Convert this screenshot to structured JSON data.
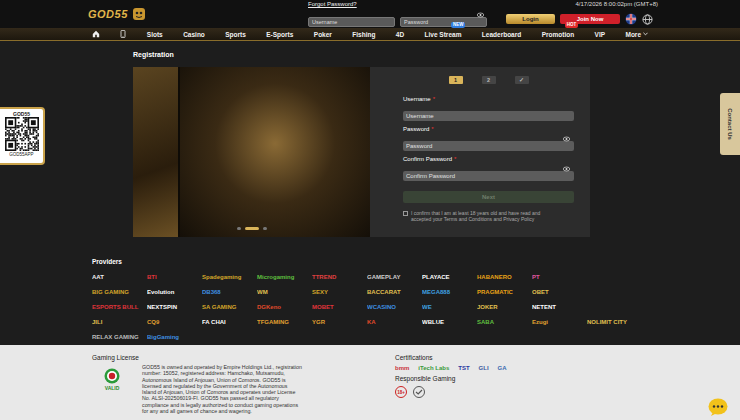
{
  "header": {
    "logo": "GOD55",
    "forgot_password": "Forgot Password?",
    "username": {
      "placeholder": "Username"
    },
    "password": {
      "placeholder": "Password"
    },
    "login": "Login",
    "join": "Join Now",
    "datetime": "4/17/2026 8:00:02pm (GMT+8)"
  },
  "nav": [
    {
      "label": "Slots"
    },
    {
      "label": "Casino"
    },
    {
      "label": "Sports"
    },
    {
      "label": "E-Sports"
    },
    {
      "label": "Poker"
    },
    {
      "label": "Fishing"
    },
    {
      "label": "4D"
    },
    {
      "label": "Live Stream",
      "badge": "NEW",
      "badge_color": "#2f7de1"
    },
    {
      "label": "Leaderboard"
    },
    {
      "label": "Promotion",
      "badge": "HOT",
      "badge_color": "#e02a2a"
    },
    {
      "label": "VIP"
    },
    {
      "label": "More"
    }
  ],
  "registration": {
    "title": "Registration",
    "slides": [
      {
        "selected": false
      },
      {
        "selected": true
      },
      {
        "selected": false
      }
    ],
    "steps": [
      {
        "label": "1",
        "selected": true
      },
      {
        "label": "2",
        "selected": false
      },
      {
        "label": "✓",
        "selected": false
      }
    ],
    "fields": [
      {
        "label": "Username",
        "required": "*",
        "placeholder": "Username",
        "kind": "text"
      },
      {
        "label": "Password",
        "required": "*",
        "placeholder": "Password",
        "kind": "password"
      },
      {
        "label": "Confirm Password",
        "required": "*",
        "placeholder": "Confirm Password",
        "kind": "password"
      }
    ],
    "submit": {
      "label": "Next",
      "disabled": true
    },
    "agree": {
      "text": "I confirm that I am at least 18 years old and have read and accepted your Terms and Conditions and Privacy Policy",
      "checked": false
    }
  },
  "qr": {
    "title": "GOD55",
    "caption": "GOD55APP"
  },
  "contact": {
    "label": "Contact Us"
  },
  "providers": {
    "title": "Providers",
    "rows": [
      [
        {
          "name": "AAT",
          "color": "#f0f0f0"
        },
        {
          "name": "BTI",
          "color": "#e0343a"
        },
        {
          "name": "Spadegaming",
          "color": "#d4a62a"
        },
        {
          "name": "Microgaming",
          "color": "#5fbf3f"
        },
        {
          "name": "TTREND",
          "color": "#e04040"
        },
        {
          "name": "GAMEPLAY",
          "color": "#cfcfcf"
        },
        {
          "name": "PLAYACE",
          "color": "#ffffff"
        },
        {
          "name": "HABANERO",
          "color": "#e8a317"
        },
        {
          "name": "PT",
          "color": "#e056a0"
        }
      ],
      [
        {
          "name": "BIG GAMING",
          "color": "#d4a62a"
        },
        {
          "name": "Evolution",
          "color": "#ffffff"
        },
        {
          "name": "DB368",
          "color": "#3f8fe0"
        },
        {
          "name": "WM",
          "color": "#e0c050"
        },
        {
          "name": "SEXY",
          "color": "#d4a62a"
        },
        {
          "name": "BACCARAT",
          "color": "#e0c050"
        },
        {
          "name": "MEGA888",
          "color": "#3fa0e0"
        },
        {
          "name": "PRAGMATIC",
          "color": "#e8a317"
        },
        {
          "name": "OBET",
          "color": "#e0c050"
        }
      ],
      [
        {
          "name": "ESPORTS BULL",
          "color": "#e0343a"
        },
        {
          "name": "NEXTSPIN",
          "color": "#ffffff"
        },
        {
          "name": "SA GAMING",
          "color": "#d4a62a"
        },
        {
          "name": "DGKeno",
          "color": "#e04a2a"
        },
        {
          "name": "MOBET",
          "color": "#e0343a"
        },
        {
          "name": "WCASINO",
          "color": "#3f8fe0"
        },
        {
          "name": "WE",
          "color": "#3fa0e0"
        },
        {
          "name": "JOKER",
          "color": "#e0c050"
        },
        {
          "name": "NETENT",
          "color": "#ffffff"
        }
      ],
      [
        {
          "name": "JILI",
          "color": "#e0c050"
        },
        {
          "name": "CQ9",
          "color": "#e0a030"
        },
        {
          "name": "FA CHAI",
          "color": "#ffffff"
        },
        {
          "name": "TFGAMING",
          "color": "#e0a030"
        },
        {
          "name": "YGR",
          "color": "#e0a030"
        },
        {
          "name": "KA",
          "color": "#e04a2a"
        },
        {
          "name": "WBLUE",
          "color": "#ffffff"
        },
        {
          "name": "SABA",
          "color": "#5fbf3f"
        },
        {
          "name": "Ezugi",
          "color": "#e0a030"
        },
        {
          "name": "NOLIMIT CITY",
          "color": "#e0c050"
        }
      ],
      [
        {
          "name": "RELAX GAMING",
          "color": "#bbbbbb"
        },
        {
          "name": "BigGaming",
          "color": "#3f8fe0"
        }
      ]
    ]
  },
  "footer": {
    "license": {
      "title": "Gaming License",
      "badge": "VALID",
      "text": "GOD55 is owned and operated by Empire Holdings Ltd., registration number: 15052, registered address: Hamchako, Mutsamudu, Autonomous Island of Anjouan, Union of Comoros. GOD55 is licensed and regulated by the Government of the Autonomous Island of Anjouan, Union of Comoros and operates under License No. ALSI-202506019-FI. GOD55 has passed all regulatory compliance and is legally authorized to conduct gaming operations for any and all games of chance and wagering."
    },
    "certifications": {
      "title": "Certifications",
      "items": [
        {
          "name": "bmm",
          "color": "#c8333a"
        },
        {
          "name": "iTech Labs",
          "color": "#3a9a3a"
        },
        {
          "name": "TST",
          "color": "#2a3aa0"
        },
        {
          "name": "GLI",
          "color": "#3a5aa0"
        },
        {
          "name": "GA",
          "color": "#3a6ab0"
        }
      ]
    },
    "responsible": {
      "title": "Responsible Gaming",
      "items": [
        "18+"
      ]
    }
  }
}
